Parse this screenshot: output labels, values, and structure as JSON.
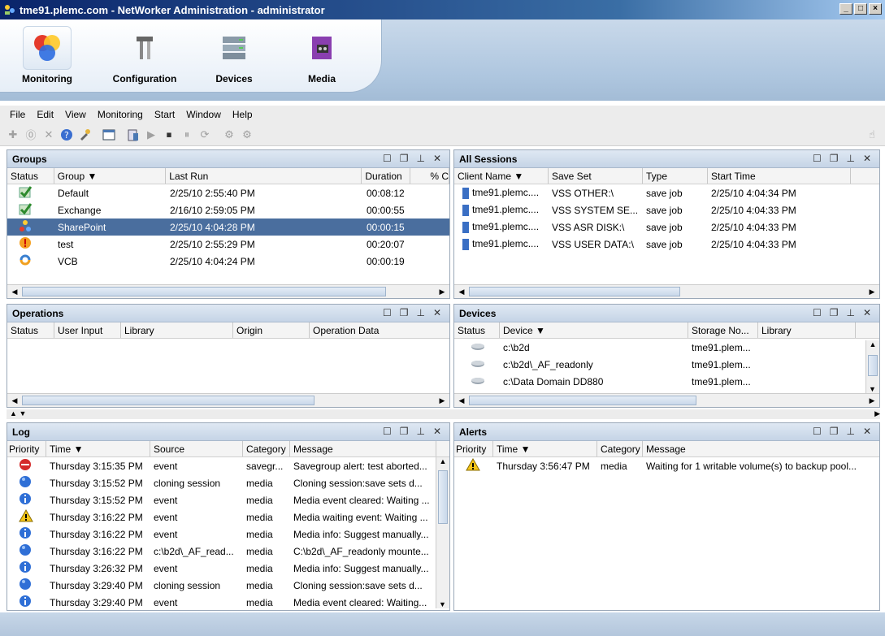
{
  "window": {
    "title": "tme91.plemc.com - NetWorker Administration - administrator"
  },
  "launcher": [
    {
      "label": "Monitoring"
    },
    {
      "label": "Configuration"
    },
    {
      "label": "Devices"
    },
    {
      "label": "Media"
    }
  ],
  "menu": [
    "File",
    "Edit",
    "View",
    "Monitoring",
    "Start",
    "Window",
    "Help"
  ],
  "groups": {
    "title": "Groups",
    "columns": [
      "Status",
      "Group",
      "Last Run",
      "Duration",
      "% C"
    ],
    "rows": [
      {
        "status": "ok",
        "group": "Default",
        "last_run": "2/25/10 2:55:40 PM",
        "duration": "00:08:12"
      },
      {
        "status": "ok",
        "group": "Exchange",
        "last_run": "2/16/10 2:59:05 PM",
        "duration": "00:00:55"
      },
      {
        "status": "running",
        "group": "SharePoint",
        "last_run": "2/25/10 4:04:28 PM",
        "duration": "00:00:15"
      },
      {
        "status": "warning",
        "group": "test",
        "last_run": "2/25/10 2:55:29 PM",
        "duration": "00:20:07"
      },
      {
        "status": "cloning",
        "group": "VCB",
        "last_run": "2/25/10 4:04:24 PM",
        "duration": "00:00:19"
      }
    ]
  },
  "sessions": {
    "title": "All Sessions",
    "columns": [
      "Client Name",
      "Save Set",
      "Type",
      "Start Time"
    ],
    "rows": [
      {
        "client": "tme91.plemc....",
        "saveset": "VSS OTHER:\\",
        "type": "save job",
        "start": "2/25/10 4:04:34 PM"
      },
      {
        "client": "tme91.plemc....",
        "saveset": "VSS SYSTEM SE...",
        "type": "save job",
        "start": "2/25/10 4:04:33 PM"
      },
      {
        "client": "tme91.plemc....",
        "saveset": "VSS ASR DISK:\\",
        "type": "save job",
        "start": "2/25/10 4:04:33 PM"
      },
      {
        "client": "tme91.plemc....",
        "saveset": "VSS USER DATA:\\",
        "type": "save job",
        "start": "2/25/10 4:04:33 PM"
      }
    ]
  },
  "operations": {
    "title": "Operations",
    "columns": [
      "Status",
      "User Input",
      "Library",
      "Origin",
      "Operation Data"
    ]
  },
  "devices": {
    "title": "Devices",
    "columns": [
      "Status",
      "Device",
      "Storage No...",
      "Library"
    ],
    "rows": [
      {
        "device": "c:\\b2d",
        "storage": "tme91.plem..."
      },
      {
        "device": "c:\\b2d\\_AF_readonly",
        "storage": "tme91.plem..."
      },
      {
        "device": "c:\\Data Domain DD880",
        "storage": "tme91.plem..."
      }
    ]
  },
  "log": {
    "title": "Log",
    "columns": [
      "Priority",
      "Time",
      "Source",
      "Category",
      "Message"
    ],
    "rows": [
      {
        "priority": "alert",
        "time": "Thursday 3:15:35 PM",
        "source": "event",
        "category": "savegr...",
        "message": "Savegroup alert: test aborted..."
      },
      {
        "priority": "notice",
        "time": "Thursday 3:15:52 PM",
        "source": "cloning session",
        "category": "media",
        "message": "Cloning session:save sets d..."
      },
      {
        "priority": "info",
        "time": "Thursday 3:15:52 PM",
        "source": "event",
        "category": "media",
        "message": "Media event cleared: Waiting ..."
      },
      {
        "priority": "warning",
        "time": "Thursday 3:16:22 PM",
        "source": "event",
        "category": "media",
        "message": "Media waiting event: Waiting ..."
      },
      {
        "priority": "info",
        "time": "Thursday 3:16:22 PM",
        "source": "event",
        "category": "media",
        "message": "Media info: Suggest manually..."
      },
      {
        "priority": "notice",
        "time": "Thursday 3:16:22 PM",
        "source": "c:\\b2d\\_AF_read...",
        "category": "media",
        "message": "C:\\b2d\\_AF_readonly mounte..."
      },
      {
        "priority": "info",
        "time": "Thursday 3:26:32 PM",
        "source": "event",
        "category": "media",
        "message": "Media info: Suggest manually..."
      },
      {
        "priority": "notice",
        "time": "Thursday 3:29:40 PM",
        "source": "cloning session",
        "category": "media",
        "message": "Cloning session:save sets d..."
      },
      {
        "priority": "info",
        "time": "Thursday 3:29:40 PM",
        "source": "event",
        "category": "media",
        "message": "Media event cleared: Waiting..."
      }
    ]
  },
  "alerts": {
    "title": "Alerts",
    "columns": [
      "Priority",
      "Time",
      "Category",
      "Message"
    ],
    "rows": [
      {
        "priority": "warning",
        "time": "Thursday 3:56:47 PM",
        "category": "media",
        "message": "Waiting for 1 writable volume(s) to backup pool..."
      }
    ]
  },
  "colors": {
    "selection": "#4a6e9e",
    "panel_header": "#c5d4e6",
    "title_bar": "#0a246a"
  }
}
